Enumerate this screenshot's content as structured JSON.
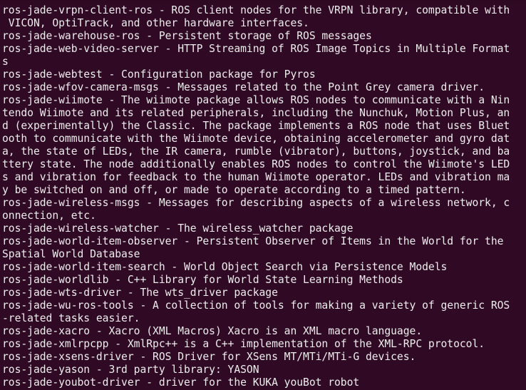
{
  "terminal": {
    "top_cut_text": "                                                                                          ",
    "lines": [
      "ros-jade-vrpn-client-ros - ROS client nodes for the VRPN library, compatible with",
      " VICON, OptiTrack, and other hardware interfaces.",
      "ros-jade-warehouse-ros - Persistent storage of ROS messages",
      "ros-jade-web-video-server - HTTP Streaming of ROS Image Topics in Multiple Format",
      "s",
      "ros-jade-webtest - Configuration package for Pyros",
      "ros-jade-wfov-camera-msgs - Messages related to the Point Grey camera driver.",
      "ros-jade-wiimote - The wiimote package allows ROS nodes to communicate with a Nin",
      "tendo Wiimote and its related peripherals, including the Nunchuk, Motion Plus, an",
      "d (experimentally) the Classic. The package implements a ROS node that uses Bluet",
      "ooth to communicate with the Wiimote device, obtaining accelerometer and gyro dat",
      "a, the state of LEDs, the IR camera, rumble (vibrator), buttons, joystick, and ba",
      "ttery state. The node additionally enables ROS nodes to control the Wiimote's LED",
      "s and vibration for feedback to the human Wiimote operator. LEDs and vibration ma",
      "y be switched on and off, or made to operate according to a timed pattern.",
      "ros-jade-wireless-msgs - Messages for describing aspects of a wireless network, c",
      "onnection, etc.",
      "ros-jade-wireless-watcher - The wireless_watcher package",
      "ros-jade-world-item-observer - Persistent Observer of Items in the World for the",
      "Spatial World Database",
      "ros-jade-world-item-search - World Object Search via Persistence Models",
      "ros-jade-worldlib - C++ Library for World State Learning Methods",
      "ros-jade-wts-driver - The wts_driver package",
      "ros-jade-wu-ros-tools - A collection of tools for making a variety of generic ROS",
      "-related tasks easier.",
      "ros-jade-xacro - Xacro (XML Macros) Xacro is an XML macro language.",
      "ros-jade-xmlrpcpp - XmlRpc++ is a C++ implementation of the XML-RPC protocol.",
      "ros-jade-xsens-driver - ROS Driver for XSens MT/MTi/MTi-G devices.",
      "ros-jade-yason - 3rd party library: YASON",
      "ros-jade-youbot-driver - driver for the KUKA youBot robot"
    ]
  },
  "colors": {
    "background": "#300a24",
    "foreground": "#ededed"
  }
}
